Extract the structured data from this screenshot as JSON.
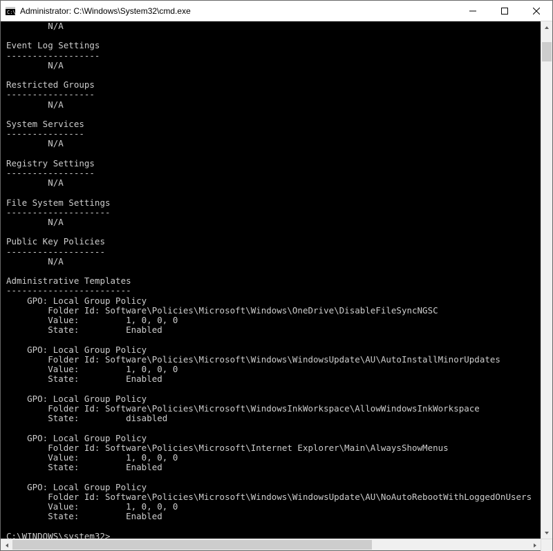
{
  "window": {
    "title": "Administrator: C:\\Windows\\System32\\cmd.exe"
  },
  "na": "N/A",
  "sections": [
    {
      "title": "Event Log Settings",
      "underline": "------------------"
    },
    {
      "title": "Restricted Groups",
      "underline": "-----------------"
    },
    {
      "title": "System Services",
      "underline": "---------------"
    },
    {
      "title": "Registry Settings",
      "underline": "-----------------"
    },
    {
      "title": "File System Settings",
      "underline": "--------------------"
    },
    {
      "title": "Public Key Policies",
      "underline": "-------------------"
    }
  ],
  "admin_header": {
    "title": "Administrative Templates",
    "underline": "------------------------"
  },
  "gpo_label": "GPO: Local Group Policy",
  "field_labels": {
    "folder": "Folder Id:",
    "value": "Value:",
    "state": "State:"
  },
  "gpos": [
    {
      "folder": "Software\\Policies\\Microsoft\\Windows\\OneDrive\\DisableFileSyncNGSC",
      "value": "1, 0, 0, 0",
      "state": "Enabled"
    },
    {
      "folder": "Software\\Policies\\Microsoft\\Windows\\WindowsUpdate\\AU\\AutoInstallMinorUpdates",
      "value": "1, 0, 0, 0",
      "state": "Enabled"
    },
    {
      "folder": "Software\\Policies\\Microsoft\\WindowsInkWorkspace\\AllowWindowsInkWorkspace",
      "state": "disabled"
    },
    {
      "folder": "Software\\Policies\\Microsoft\\Internet Explorer\\Main\\AlwaysShowMenus",
      "value": "1, 0, 0, 0",
      "state": "Enabled"
    },
    {
      "folder": "Software\\Policies\\Microsoft\\Windows\\WindowsUpdate\\AU\\NoAutoRebootWithLoggedOnUsers",
      "value": "1, 0, 0, 0",
      "state": "Enabled"
    }
  ],
  "prompt": "C:\\WINDOWS\\system32>"
}
